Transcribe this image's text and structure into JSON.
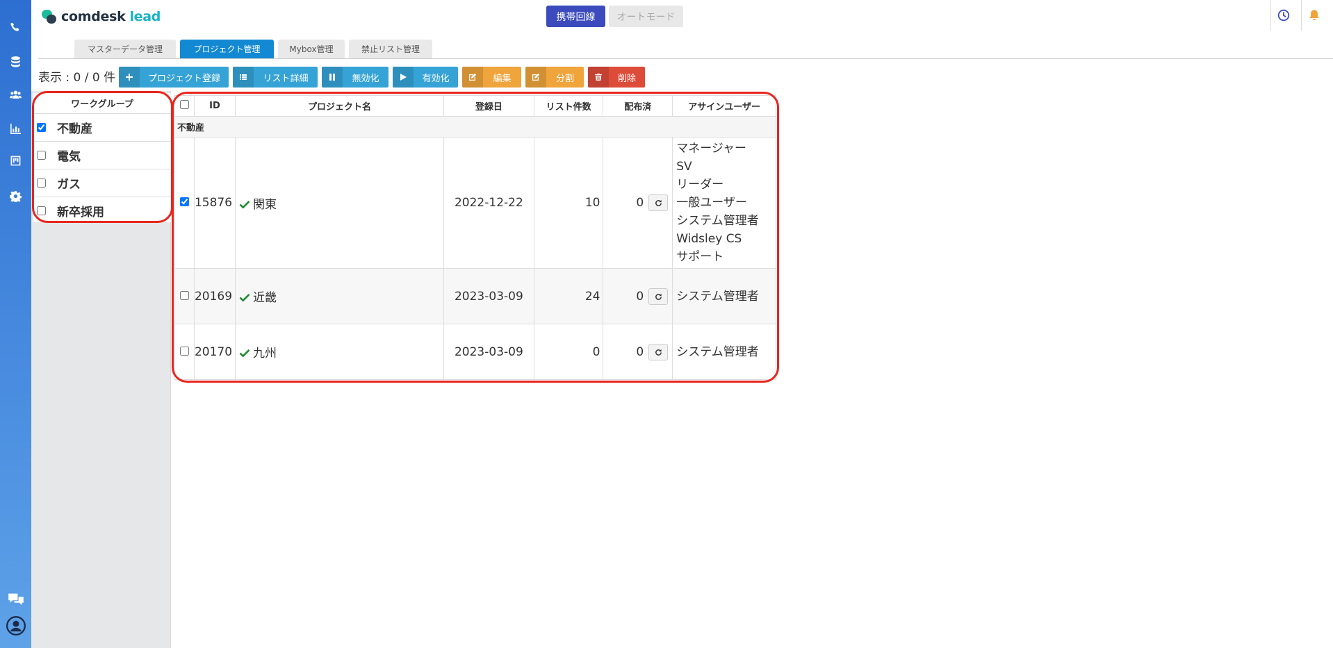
{
  "header": {
    "logo": {
      "part1": "comdesk",
      "part2": "lead"
    },
    "mobile_button": "携帯回線",
    "auto_mode_button": "オートモード"
  },
  "rail_icons": [
    "phone-icon",
    "database-icon",
    "users-icon",
    "bar-chart-icon",
    "kanban-icon",
    "gear-icon",
    "help-chat-icon",
    "user-avatar-icon"
  ],
  "tabs": [
    {
      "label": "マスターデータ管理",
      "active": false
    },
    {
      "label": "プロジェクト管理",
      "active": true
    },
    {
      "label": "Mybox管理",
      "active": false
    },
    {
      "label": "禁止リスト管理",
      "active": false
    }
  ],
  "toolbar": {
    "count": "表示 : 0 / 0 件",
    "buttons": [
      {
        "label": "プロジェクト登録",
        "icon": "plus-icon",
        "color": "#36a3d6"
      },
      {
        "label": "リスト詳細",
        "icon": "list-icon",
        "color": "#36a3d6"
      },
      {
        "label": "無効化",
        "icon": "pause-icon",
        "color": "#36a3d6"
      },
      {
        "label": "有効化",
        "icon": "play-icon",
        "color": "#36a3d6"
      },
      {
        "label": "編集",
        "icon": "edit-icon",
        "color": "#f0a43c"
      },
      {
        "label": "分割",
        "icon": "split-icon",
        "color": "#f0a43c"
      },
      {
        "label": "削除",
        "icon": "trash-icon",
        "color": "#dd4b39"
      }
    ]
  },
  "workgroup": {
    "title": "ワークグループ",
    "items": [
      {
        "label": "不動産",
        "checked": true
      },
      {
        "label": "電気",
        "checked": false
      },
      {
        "label": "ガス",
        "checked": false
      },
      {
        "label": "新卒採用",
        "checked": false
      }
    ]
  },
  "table": {
    "columns": [
      "",
      "ID",
      "プロジェクト名",
      "登録日",
      "リスト件数",
      "配布済",
      "アサインユーザー"
    ],
    "group": "不動産",
    "rows": [
      {
        "checked": true,
        "id": "15876",
        "name": "関東",
        "date": "2022-12-22",
        "list_count": "10",
        "distributed": "0",
        "users": [
          "マネージャー",
          "SV",
          "リーダー",
          "一般ユーザー",
          "システム管理者",
          "Widsley CS",
          "サポート"
        ]
      },
      {
        "checked": false,
        "id": "20169",
        "name": "近畿",
        "date": "2023-03-09",
        "list_count": "24",
        "distributed": "0",
        "users": [
          "システム管理者"
        ]
      },
      {
        "checked": false,
        "id": "20170",
        "name": "九州",
        "date": "2023-03-09",
        "list_count": "0",
        "distributed": "0",
        "users": [
          "システム管理者"
        ]
      }
    ]
  },
  "colors": {
    "accent": "#1489d3",
    "highlight": "#e8261f",
    "check": "#1e8a2e"
  }
}
